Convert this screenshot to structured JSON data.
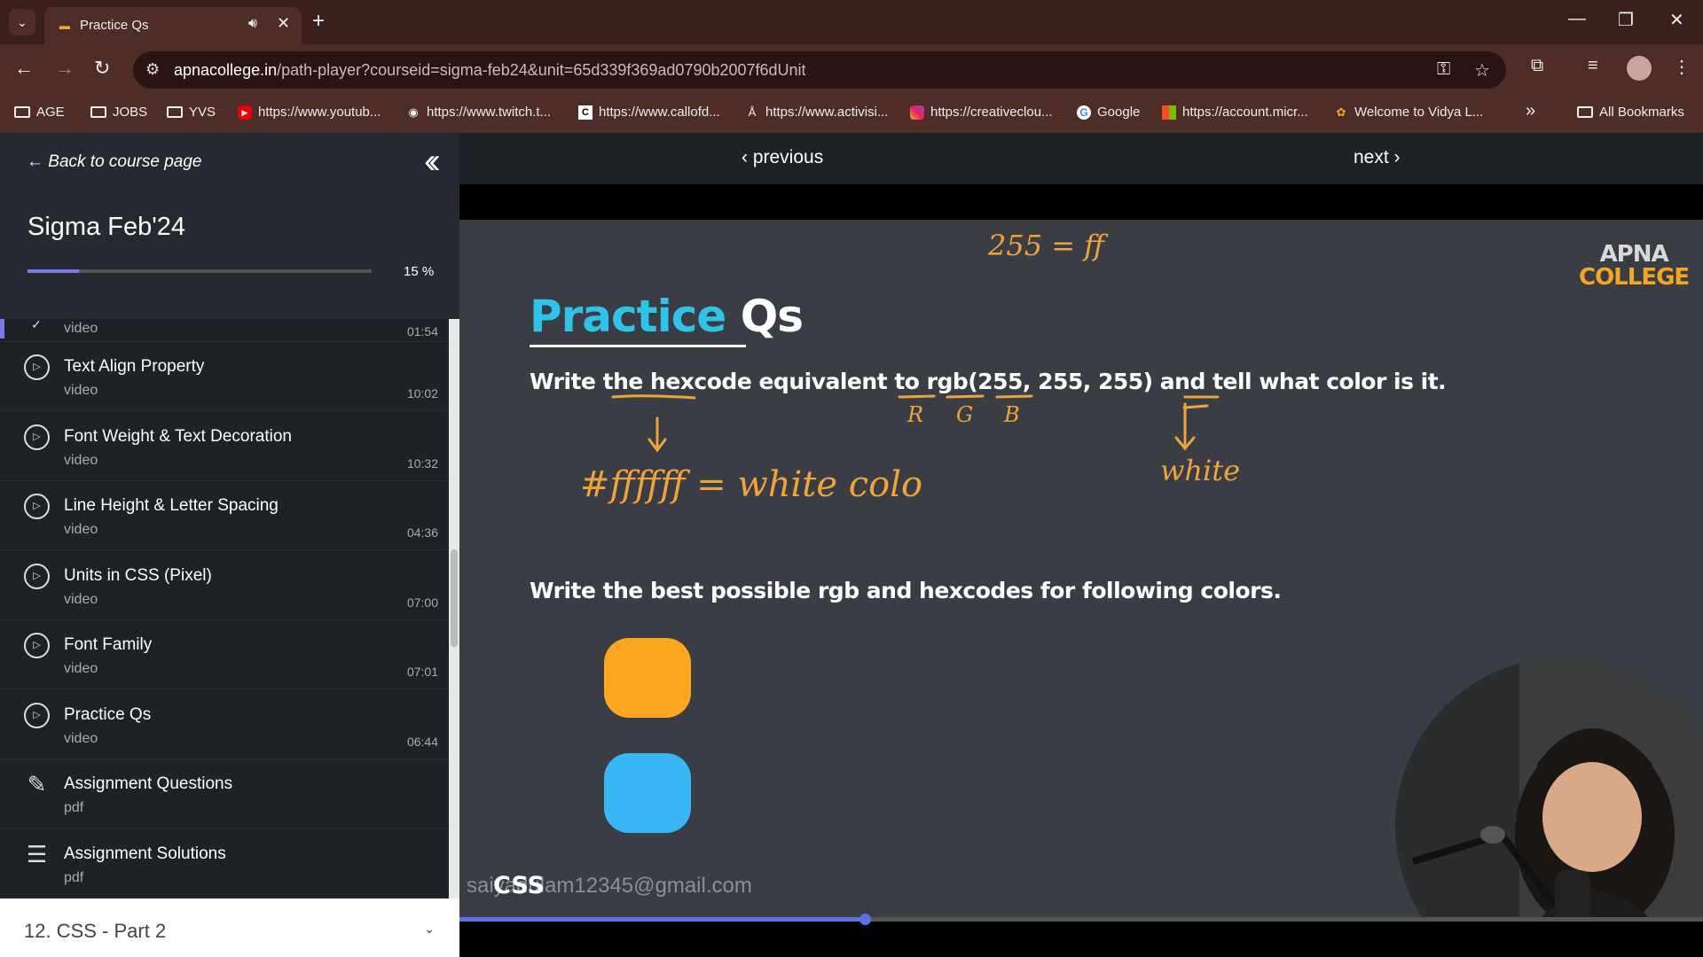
{
  "browser": {
    "tab_title": "Practice Qs",
    "url_host": "apnacollege.in",
    "url_path": "/path-player?courseid=sigma-feb24&unit=65d339f369ad0790b2007f6dUnit",
    "bookmarks": [
      {
        "label": "AGE",
        "icon": "folder-icon"
      },
      {
        "label": "JOBS",
        "icon": "folder-icon"
      },
      {
        "label": "YVS",
        "icon": "folder-icon"
      },
      {
        "label": "https://www.youtub...",
        "icon": "youtube-icon"
      },
      {
        "label": "https://www.twitch.t...",
        "icon": "globe-icon"
      },
      {
        "label": "https://www.callofd...",
        "icon": "callofduty-icon"
      },
      {
        "label": "https://www.activisi...",
        "icon": "activision-icon"
      },
      {
        "label": "https://creativeclou...",
        "icon": "creativecloud-icon"
      },
      {
        "label": "Google",
        "icon": "google-icon"
      },
      {
        "label": "https://account.micr...",
        "icon": "microsoft-icon"
      },
      {
        "label": "Welcome to Vidya L...",
        "icon": "vidya-icon"
      }
    ],
    "all_bookmarks": "All Bookmarks",
    "more_bookmarks": "»"
  },
  "sidebar": {
    "back_link": "Back to course page",
    "course_title": "Sigma Feb'24",
    "progress_percent": 15,
    "progress_label": "15 %",
    "items": [
      {
        "title": "",
        "type": "video",
        "duration": "01:54",
        "icon": "check-icon"
      },
      {
        "title": "Text Align Property",
        "type": "video",
        "duration": "10:02",
        "icon": "play-circle-icon"
      },
      {
        "title": "Font Weight & Text Decoration",
        "type": "video",
        "duration": "10:32",
        "icon": "play-circle-icon"
      },
      {
        "title": "Line Height & Letter Spacing",
        "type": "video",
        "duration": "04:36",
        "icon": "play-circle-icon"
      },
      {
        "title": "Units in CSS (Pixel)",
        "type": "video",
        "duration": "07:00",
        "icon": "play-circle-icon"
      },
      {
        "title": "Font Family",
        "type": "video",
        "duration": "07:01",
        "icon": "play-circle-icon"
      },
      {
        "title": "Practice Qs",
        "type": "video",
        "duration": "06:44",
        "icon": "play-circle-icon"
      },
      {
        "title": "Assignment Questions",
        "type": "pdf",
        "duration": "",
        "icon": "edit-document-icon"
      },
      {
        "title": "Assignment Solutions",
        "type": "pdf",
        "duration": "",
        "icon": "checklist-icon"
      }
    ],
    "next_section": "12. CSS - Part 2"
  },
  "player": {
    "previous_label": "previous",
    "next_label": "next",
    "slide": {
      "title_part1": "Practice",
      "title_part2": "Qs",
      "question1": "Write the hexcode equivalent to rgb(255, 255, 255) and tell what color is it.",
      "question2": "Write the best possible rgb and hexcodes for following colors.",
      "logo_line1": "APNA",
      "logo_line2": "COLLEGE",
      "swatch_colors": [
        "#fca71f",
        "#38b6f5"
      ],
      "annotations": {
        "top": "255 = ff",
        "r": "R",
        "g": "G",
        "b": "B",
        "hex": "#ffffff = white colo",
        "white": "white"
      },
      "watermark": "saiyadulam12345@gmail.com",
      "css_label": "CSS"
    },
    "seek_fraction": 0.326
  }
}
